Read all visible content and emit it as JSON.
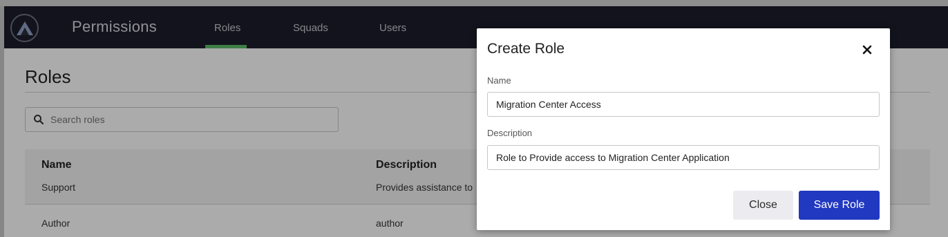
{
  "nav": {
    "app_title": "Permissions",
    "tabs": [
      {
        "label": "Roles",
        "active": true
      },
      {
        "label": "Squads",
        "active": false
      },
      {
        "label": "Users",
        "active": false
      }
    ],
    "logo_icon": "logo-icon",
    "active_tab_color": "#5bbd6a",
    "background_color": "#1b1d2b"
  },
  "page": {
    "title": "Roles",
    "search": {
      "placeholder": "Search roles",
      "value": "",
      "icon": "search-icon"
    },
    "table": {
      "columns": [
        "Name",
        "Description"
      ],
      "rows": [
        {
          "name": "Support",
          "description": "Provides assistance to"
        },
        {
          "name": "Author",
          "description": "author"
        }
      ]
    }
  },
  "modal": {
    "title": "Create Role",
    "close_icon": "close-icon",
    "name_label": "Name",
    "name_value": "Migration Center Access",
    "description_label": "Description",
    "description_value": "Role to Provide access to Migration Center Application",
    "close_button": "Close",
    "save_button": "Save Role",
    "save_button_color": "#2138c0"
  }
}
